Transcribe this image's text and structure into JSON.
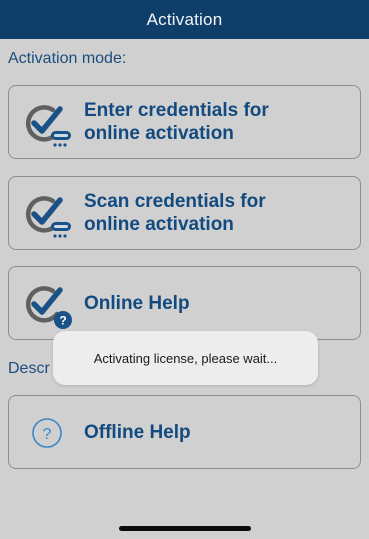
{
  "header": {
    "title": "Activation"
  },
  "activation_mode_label": "Activation mode:",
  "cards": [
    {
      "label_line1": "Enter credentials for",
      "label_line2": "online activation",
      "icon": "check-keyboard-icon"
    },
    {
      "label_line1": "Scan credentials for",
      "label_line2": "online activation",
      "icon": "check-scan-icon"
    },
    {
      "label": "Online Help",
      "icon": "check-help-icon"
    },
    {
      "label": "Offline Help",
      "icon": "question-circle-icon"
    }
  ],
  "description_label_partial": "Descr",
  "toast": {
    "message": "Activating license, please wait..."
  },
  "colors": {
    "header_bg": "#0f3e6a",
    "accent_text": "#134a7f",
    "background": "#d0d0d0",
    "toast_bg": "#ededed"
  }
}
